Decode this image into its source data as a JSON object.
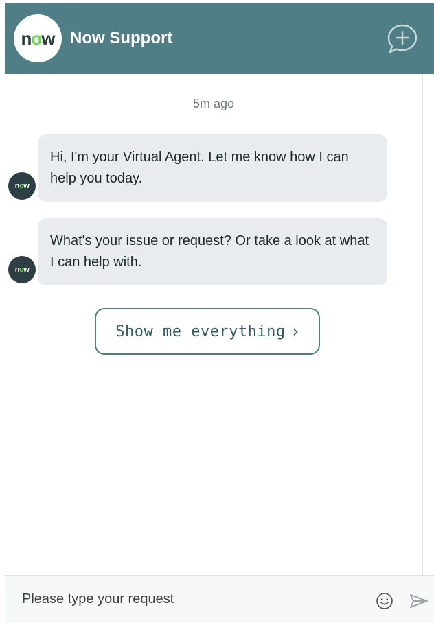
{
  "header": {
    "logo_text_pre": "n",
    "logo_text_o": "o",
    "logo_text_post": "w",
    "title": "Now Support",
    "new_chat_icon": "chat-plus-icon"
  },
  "colors": {
    "header_bg": "#4f7e86",
    "bubble_bg": "#e9ecef",
    "brand_green": "#62d84e",
    "button_text": "#2f5d66"
  },
  "chat": {
    "timestamp": "5m ago",
    "messages": [
      {
        "sender": "agent",
        "text": "Hi, I'm your Virtual Agent. Let me know how I can help you today."
      },
      {
        "sender": "agent",
        "text": "What's your issue or request? Or take a look at what I can help with."
      }
    ],
    "show_button_label": "Show me everything",
    "show_button_chevron": "›"
  },
  "composer": {
    "placeholder": "Please type your request",
    "emoji_icon": "smiley-icon",
    "send_icon": "send-arrow-icon"
  }
}
